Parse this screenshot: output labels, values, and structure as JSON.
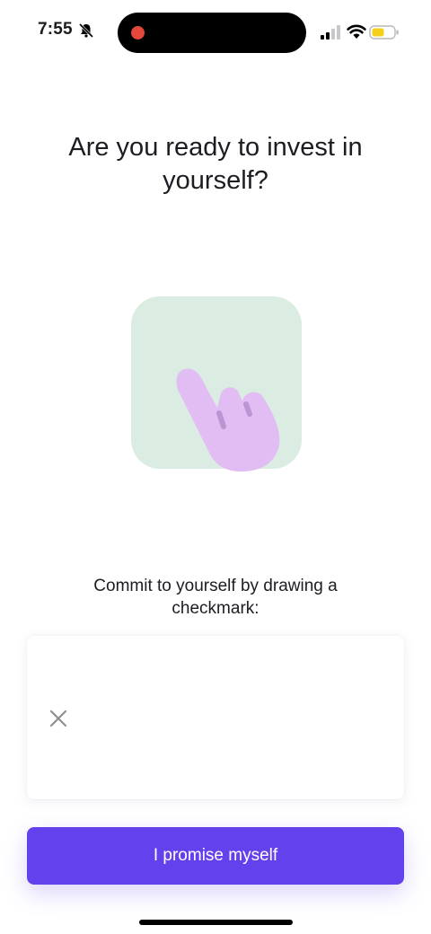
{
  "status_bar": {
    "time": "7:55",
    "icons": [
      "bell-slash-icon",
      "cellular-signal-icon",
      "wifi-icon",
      "battery-icon"
    ],
    "recording_indicator_color": "#e5483b",
    "battery_color": "#f5cf19"
  },
  "screen": {
    "headline": "Are you ready to invest in yourself?",
    "illustration_icon": "pointing-hand-icon",
    "instruction": "Commit to yourself by drawing a checkmark:",
    "clear_icon": "close-icon",
    "promise_button_label": "I promise myself"
  },
  "colors": {
    "accent": "#6342ee",
    "illustration_bg": "#dbede3",
    "hand": "#e2bdf3"
  }
}
